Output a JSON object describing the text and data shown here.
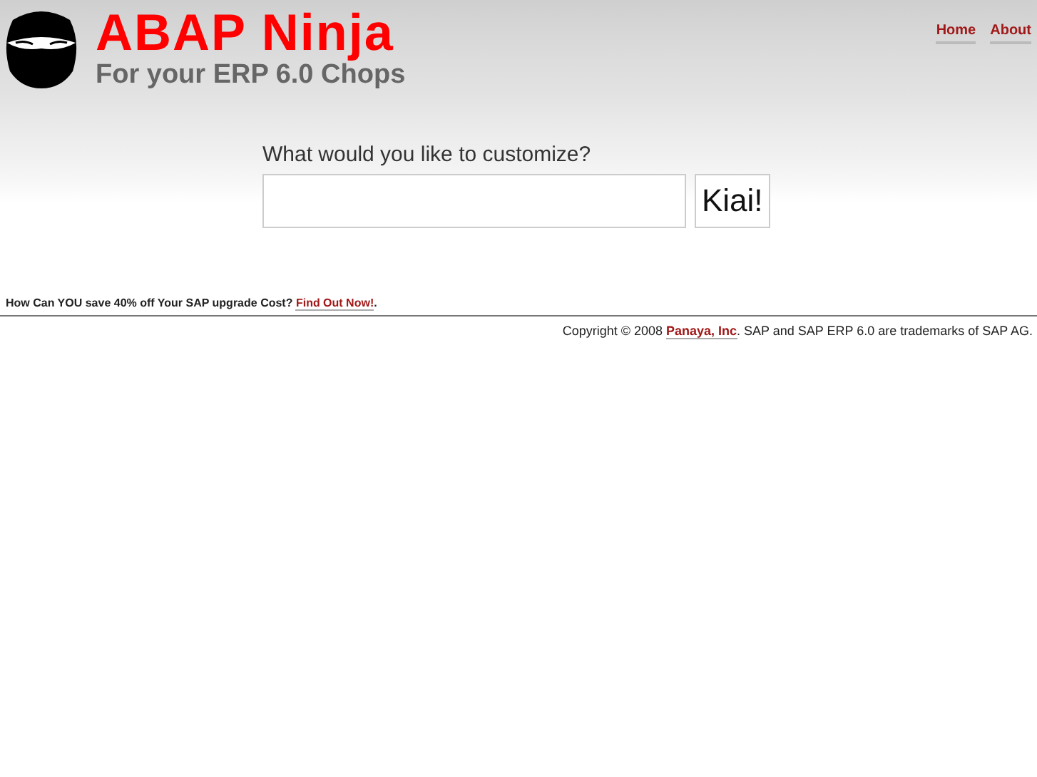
{
  "header": {
    "title": "ABAP Ninja",
    "tagline": "For your ERP 6.0 Chops"
  },
  "nav": [
    {
      "label": "Home"
    },
    {
      "label": "About"
    }
  ],
  "search": {
    "label": "What would you like to customize?",
    "button": "Kiai!"
  },
  "promo": {
    "text": "How Can YOU save 40% off Your SAP upgrade Cost? ",
    "link": "Find Out Now!",
    "after": "."
  },
  "footer": {
    "text": "Copyright © 2008 ",
    "link": "Panaya, Inc",
    "after": ". SAP and SAP ERP 6.0 are trademarks of SAP AG."
  }
}
